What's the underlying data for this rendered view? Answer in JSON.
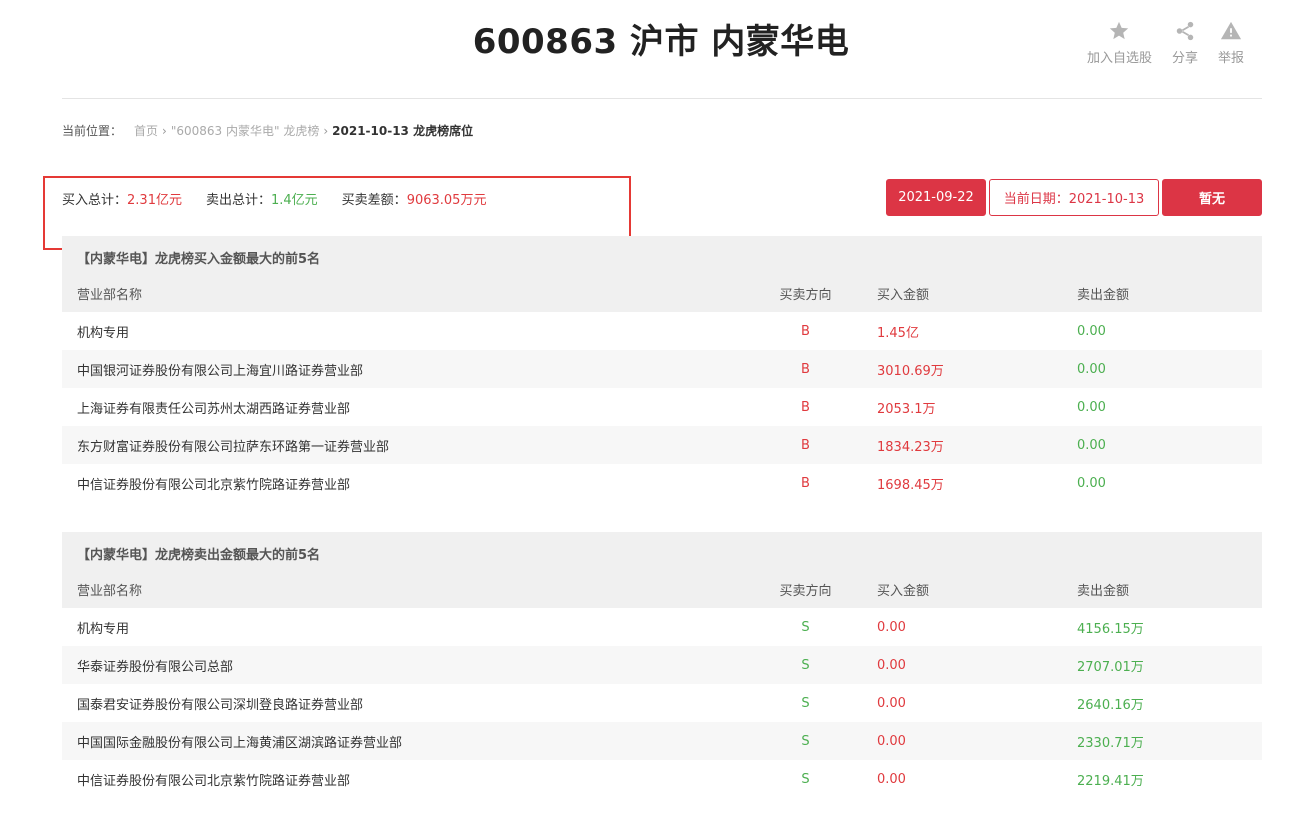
{
  "header": {
    "title": "600863 沪市 内蒙华电",
    "actions": [
      {
        "label": "加入自选股",
        "icon": "star-icon"
      },
      {
        "label": "分享",
        "icon": "share-icon"
      },
      {
        "label": "举报",
        "icon": "warning-icon"
      }
    ]
  },
  "breadcrumb": {
    "label": "当前位置：",
    "items": [
      "首页",
      "\"600863 内蒙华电\" 龙虎榜",
      "2021-10-13 龙虎榜席位"
    ]
  },
  "summary": {
    "buy_label": "买入总计：",
    "buy_value": "2.31亿元",
    "sell_label": "卖出总计：",
    "sell_value": "1.4亿元",
    "diff_label": "买卖差额：",
    "diff_value": "9063.05万元"
  },
  "date_controls": {
    "prev": "2021-09-22",
    "current": "当前日期：2021-10-13",
    "next": "暂无"
  },
  "colors": {
    "accent": "#dc3545",
    "up": "#e03a3e",
    "down": "#4caf50"
  },
  "buy_table": {
    "title": "【内蒙华电】龙虎榜买入金额最大的前5名",
    "headers": [
      "营业部名称",
      "买卖方向",
      "买入金额",
      "卖出金额"
    ],
    "rows": [
      {
        "name": "机构专用",
        "dir": "B",
        "buy": "1.45亿",
        "sell": "0.00"
      },
      {
        "name": "中国银河证券股份有限公司上海宜川路证券营业部",
        "dir": "B",
        "buy": "3010.69万",
        "sell": "0.00"
      },
      {
        "name": "上海证券有限责任公司苏州太湖西路证券营业部",
        "dir": "B",
        "buy": "2053.1万",
        "sell": "0.00"
      },
      {
        "name": "东方财富证券股份有限公司拉萨东环路第一证券营业部",
        "dir": "B",
        "buy": "1834.23万",
        "sell": "0.00"
      },
      {
        "name": "中信证券股份有限公司北京紫竹院路证券营业部",
        "dir": "B",
        "buy": "1698.45万",
        "sell": "0.00"
      }
    ]
  },
  "sell_table": {
    "title": "【内蒙华电】龙虎榜卖出金额最大的前5名",
    "headers": [
      "营业部名称",
      "买卖方向",
      "买入金额",
      "卖出金额"
    ],
    "rows": [
      {
        "name": "机构专用",
        "dir": "S",
        "buy": "0.00",
        "sell": "4156.15万"
      },
      {
        "name": "华泰证券股份有限公司总部",
        "dir": "S",
        "buy": "0.00",
        "sell": "2707.01万"
      },
      {
        "name": "国泰君安证券股份有限公司深圳登良路证券营业部",
        "dir": "S",
        "buy": "0.00",
        "sell": "2640.16万"
      },
      {
        "name": "中国国际金融股份有限公司上海黄浦区湖滨路证券营业部",
        "dir": "S",
        "buy": "0.00",
        "sell": "2330.71万"
      },
      {
        "name": "中信证券股份有限公司北京紫竹院路证券营业部",
        "dir": "S",
        "buy": "0.00",
        "sell": "2219.41万"
      }
    ]
  }
}
